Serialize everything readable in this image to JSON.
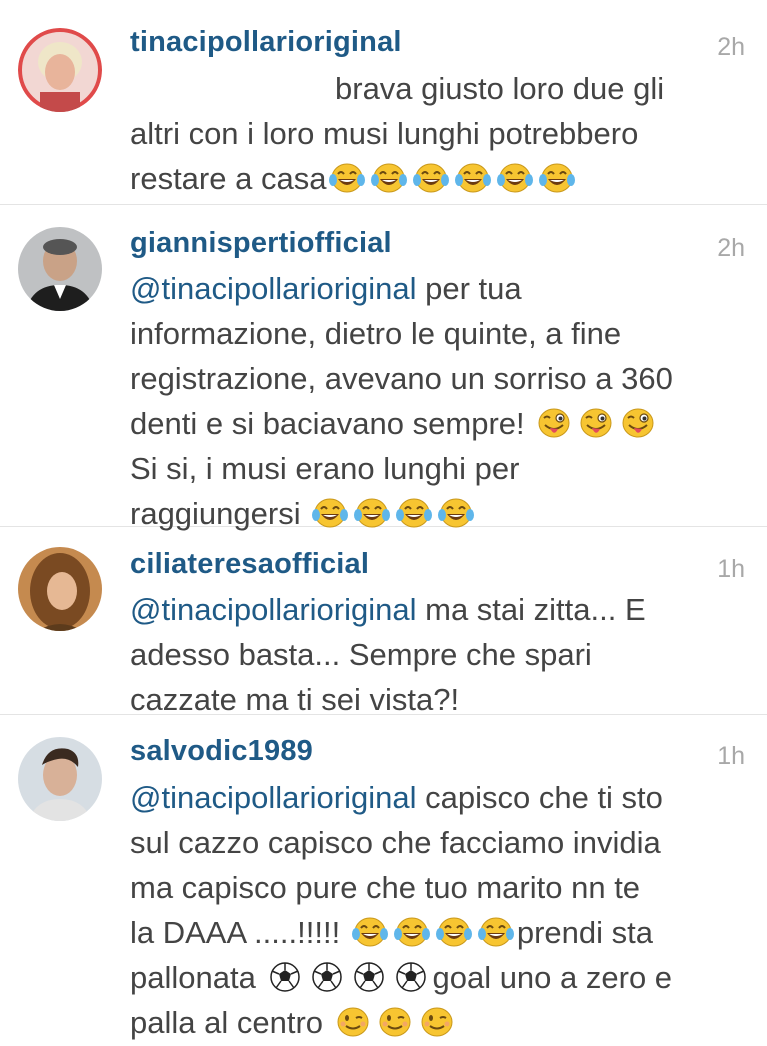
{
  "comments": [
    {
      "username": "tinacipollarioriginal",
      "time": "2h",
      "line1": "brava giusto loro due gli",
      "line2": "altri con i loro musi lunghi potrebbero",
      "line3": "restare a casa"
    },
    {
      "username": "giannispertiofficial",
      "time": "2h",
      "mention": "@tinacipollarioriginal",
      "line1": "per tua",
      "line2": "informazione, dietro le quinte, a fine",
      "line3": "registrazione, avevano un sorriso a 360",
      "line4": "denti e si baciavano sempre!",
      "line5": "Si si, i musi erano lunghi per",
      "line6": "raggiungersi"
    },
    {
      "username": "ciliateresaofficial",
      "time": "1h",
      "mention": "@tinacipollarioriginal",
      "line1": "ma stai zitta... E",
      "line2": "adesso basta... Sempre che spari",
      "line3": "cazzate ma ti sei vista?!"
    },
    {
      "username": "salvodic1989",
      "time": "1h",
      "mention": "@tinacipollarioriginal",
      "line1": "capisco che ti sto",
      "line2": "sul cazzo capisco che facciamo invidia",
      "line3": "ma capisco pure che tuo marito nn te",
      "line4a": "la DAAA .....!!!!!",
      "line4b": "prendi sta",
      "line5a": "pallonata",
      "line5b": "goal uno a zero e",
      "line6": "palla al centro"
    }
  ],
  "emoji_icons": [
    "tears-of-joy-icon",
    "winking-tongue-icon",
    "soccer-ball-icon",
    "winking-face-icon"
  ]
}
